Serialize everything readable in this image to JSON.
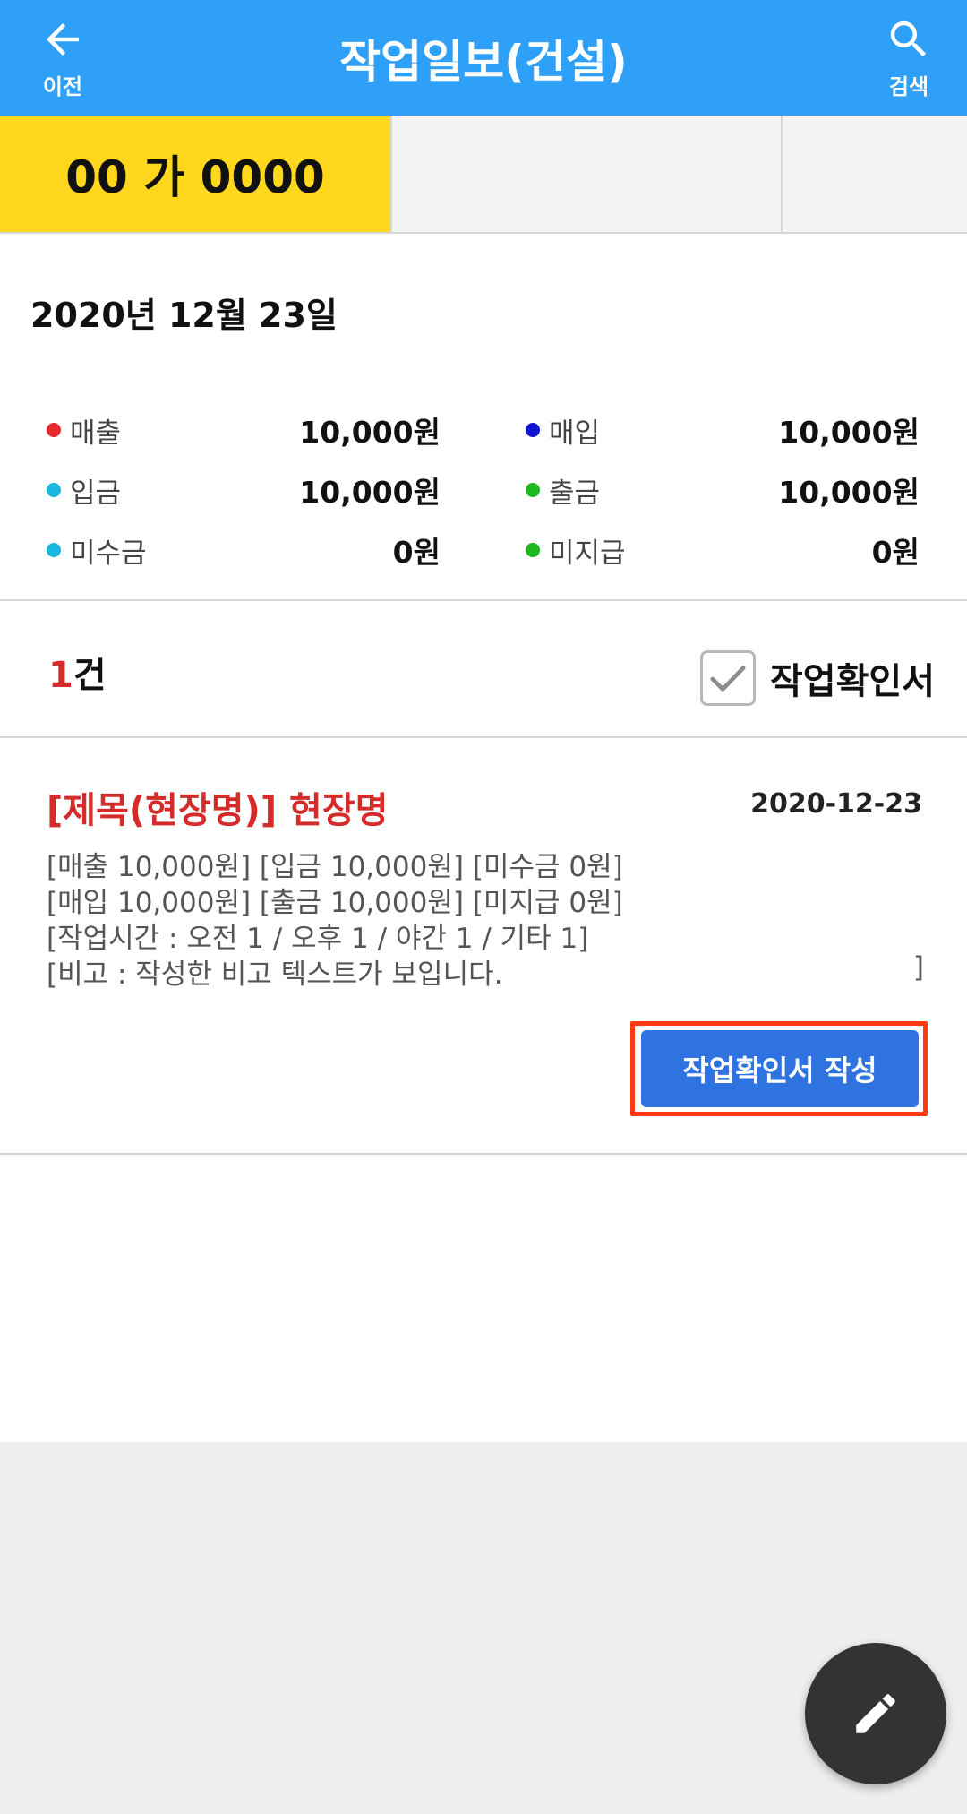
{
  "header": {
    "title": "작업일보(건설)",
    "back_label": "이전",
    "search_label": "검색",
    "color": "#2ea0f8"
  },
  "tabs": [
    {
      "label": "00 가 0000",
      "active": true
    },
    {
      "label": "",
      "active": false
    },
    {
      "label": "",
      "active": false
    }
  ],
  "summary": {
    "date": "2020년 12월 23일",
    "stats": [
      {
        "name": "매출",
        "value": "10,000원",
        "dot_color": "#e82a2a"
      },
      {
        "name": "매입",
        "value": "10,000원",
        "dot_color": "#1414d6"
      },
      {
        "name": "입금",
        "value": "10,000원",
        "dot_color": "#1ab8e0"
      },
      {
        "name": "출금",
        "value": "10,000원",
        "dot_color": "#1db81d"
      },
      {
        "name": "미수금",
        "value": "0원",
        "dot_color": "#1ab8e0"
      },
      {
        "name": "미지급",
        "value": "0원",
        "dot_color": "#1db81d"
      }
    ]
  },
  "list": {
    "count": "1",
    "count_unit": "건",
    "checkbox_label": "작업확인서",
    "checkbox_checked": true
  },
  "card": {
    "title": "[제목(현장명)] 현장명",
    "date": "2020-12-23",
    "line1": "[매출 10,000원] [입금 10,000원] [미수금 0원]",
    "line2": "[매입 10,000원] [출금 10,000원] [미지급 0원]",
    "line3": "[작업시간 : 오전 1 / 오후 1 / 야간 1 / 기타 1]",
    "line4": "[비고 : 작성한 비고 텍스트가 보입니다.",
    "line4_close": "]",
    "button_label": "작업확인서 작성"
  },
  "fab": {
    "icon": "pencil-icon"
  }
}
